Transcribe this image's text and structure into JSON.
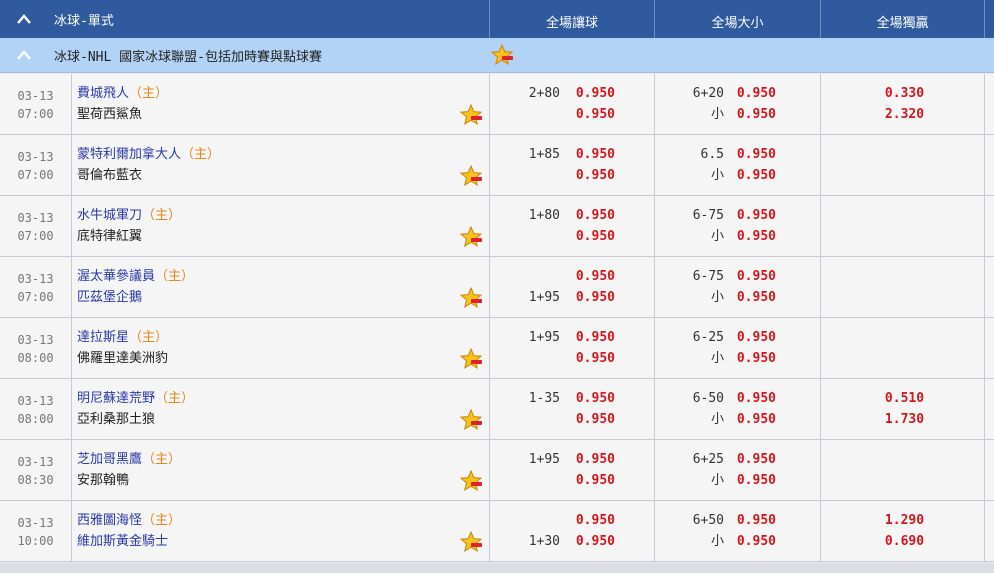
{
  "header": {
    "sport_title": "冰球-單式",
    "col_handicap": "全場讓球",
    "col_overunder": "全場大小",
    "col_moneyline": "全場獨贏"
  },
  "league": {
    "name": "冰球-NHL 國家冰球聯盟-包括加時賽與點球賽"
  },
  "home_tag": "（主）",
  "under_label": "小",
  "colors": {
    "header": "#2f5b9e",
    "league": "#b3d3f6",
    "odds": "#d4161d",
    "home": "#2b3aa8",
    "tag": "#e08a1b"
  },
  "matches": [
    {
      "date": "03-13",
      "time": "07:00",
      "home": "費城飛人",
      "away": "聖荷西鯊魚",
      "hdp_line_1": "2+80",
      "hdp_odds_1": "0.950",
      "hdp_line_2": "",
      "hdp_odds_2": "0.950",
      "ou_line_1": "6+20",
      "ou_odds_1": "0.950",
      "ou_odds_2": "0.950",
      "ml_1": "0.330",
      "ml_2": "2.320"
    },
    {
      "date": "03-13",
      "time": "07:00",
      "home": "蒙特利爾加拿大人",
      "away": "哥倫布藍衣",
      "hdp_line_1": "1+85",
      "hdp_odds_1": "0.950",
      "hdp_line_2": "",
      "hdp_odds_2": "0.950",
      "ou_line_1": "6.5",
      "ou_odds_1": "0.950",
      "ou_odds_2": "0.950",
      "ml_1": "",
      "ml_2": ""
    },
    {
      "date": "03-13",
      "time": "07:00",
      "home": "水牛城軍刀",
      "away": "底特律紅翼",
      "hdp_line_1": "1+80",
      "hdp_odds_1": "0.950",
      "hdp_line_2": "",
      "hdp_odds_2": "0.950",
      "ou_line_1": "6-75",
      "ou_odds_1": "0.950",
      "ou_odds_2": "0.950",
      "ml_1": "",
      "ml_2": ""
    },
    {
      "date": "03-13",
      "time": "07:00",
      "home": "渥太華參議員",
      "away": "匹茲堡企鵝",
      "hdp_line_1": "",
      "hdp_odds_1": "0.950",
      "hdp_line_2": "1+95",
      "hdp_odds_2": "0.950",
      "ou_line_1": "6-75",
      "ou_odds_1": "0.950",
      "ou_odds_2": "0.950",
      "ml_1": "",
      "ml_2": ""
    },
    {
      "date": "03-13",
      "time": "08:00",
      "home": "達拉斯星",
      "away": "佛羅里達美洲豹",
      "hdp_line_1": "1+95",
      "hdp_odds_1": "0.950",
      "hdp_line_2": "",
      "hdp_odds_2": "0.950",
      "ou_line_1": "6-25",
      "ou_odds_1": "0.950",
      "ou_odds_2": "0.950",
      "ml_1": "",
      "ml_2": ""
    },
    {
      "date": "03-13",
      "time": "08:00",
      "home": "明尼蘇達荒野",
      "away": "亞利桑那土狼",
      "hdp_line_1": "1-35",
      "hdp_odds_1": "0.950",
      "hdp_line_2": "",
      "hdp_odds_2": "0.950",
      "ou_line_1": "6-50",
      "ou_odds_1": "0.950",
      "ou_odds_2": "0.950",
      "ml_1": "0.510",
      "ml_2": "1.730"
    },
    {
      "date": "03-13",
      "time": "08:30",
      "home": "芝加哥黑鷹",
      "away": "安那翰鴨",
      "hdp_line_1": "1+95",
      "hdp_odds_1": "0.950",
      "hdp_line_2": "",
      "hdp_odds_2": "0.950",
      "ou_line_1": "6+25",
      "ou_odds_1": "0.950",
      "ou_odds_2": "0.950",
      "ml_1": "",
      "ml_2": ""
    },
    {
      "date": "03-13",
      "time": "10:00",
      "home": "西雅圖海怪",
      "away": "維加斯黃金騎士",
      "hdp_line_1": "",
      "hdp_odds_1": "0.950",
      "hdp_line_2": "1+30",
      "hdp_odds_2": "0.950",
      "ou_line_1": "6+50",
      "ou_odds_1": "0.950",
      "ou_odds_2": "0.950",
      "ml_1": "1.290",
      "ml_2": "0.690"
    }
  ]
}
